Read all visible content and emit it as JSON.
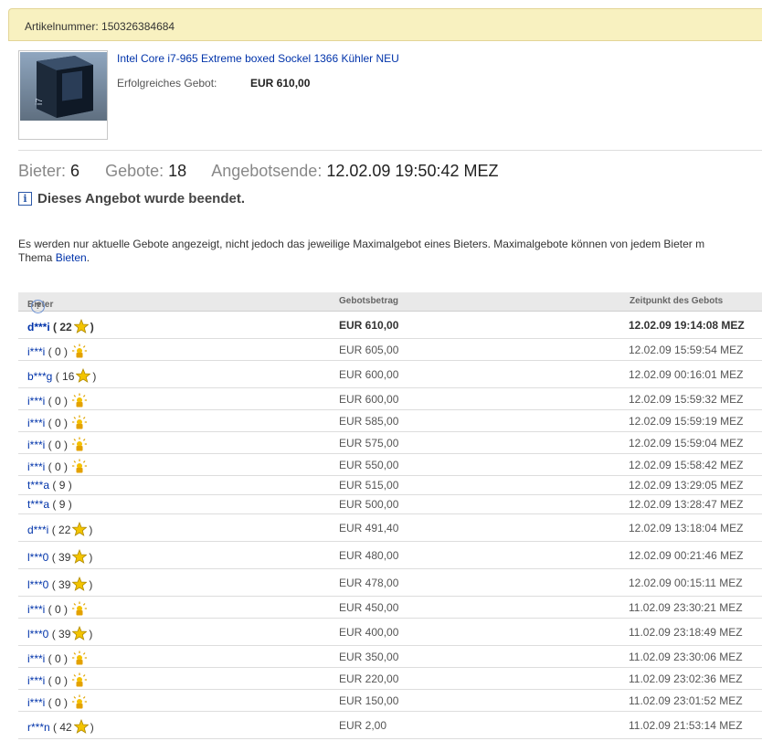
{
  "item": {
    "number_label": "Artikelnummer: 150326384684",
    "title": "Intel Core i7-965 Extreme boxed Sockel 1366 Kühler NEU",
    "winning_label": "Erfolgreiches Gebot:",
    "winning_value": "EUR 610,00"
  },
  "summary": {
    "bidders_label": "Bieter:",
    "bidders_value": "6",
    "bids_label": "Gebote:",
    "bids_value": "18",
    "end_label": "Angebotsende:",
    "end_value": "12.02.09 19:50:42 MEZ"
  },
  "info": {
    "text": "Dieses Angebot wurde beendet."
  },
  "note": {
    "line1": "Es werden nur aktuelle Gebote angezeigt, nicht jedoch das jeweilige Maximalgebot eines Bieters. Maximalgebote können von jedem Bieter m",
    "line2_prefix": "Thema ",
    "link": "Bieten",
    "line2_suffix": "."
  },
  "table": {
    "headers": {
      "bidder": "Bieter",
      "help": "?",
      "amount": "Gebotsbetrag",
      "time": "Zeitpunkt des Gebots"
    },
    "rows": [
      {
        "user": "d***i",
        "score": "( 22",
        "close": ")",
        "icon": "star-icon",
        "amount": "EUR 610,00",
        "time": "12.02.09 19:14:08 MEZ"
      },
      {
        "user": "i***i",
        "score": "( 0 )",
        "close": "",
        "icon": "new-member-icon",
        "amount": "EUR 605,00",
        "time": "12.02.09 15:59:54 MEZ"
      },
      {
        "user": "b***g",
        "score": "( 16",
        "close": ")",
        "icon": "star-icon",
        "amount": "EUR 600,00",
        "time": "12.02.09 00:16:01 MEZ"
      },
      {
        "user": "i***i",
        "score": "( 0 )",
        "close": "",
        "icon": "new-member-icon",
        "amount": "EUR 600,00",
        "time": "12.02.09 15:59:32 MEZ"
      },
      {
        "user": "i***i",
        "score": "( 0 )",
        "close": "",
        "icon": "new-member-icon",
        "amount": "EUR 585,00",
        "time": "12.02.09 15:59:19 MEZ"
      },
      {
        "user": "i***i",
        "score": "( 0 )",
        "close": "",
        "icon": "new-member-icon",
        "amount": "EUR 575,00",
        "time": "12.02.09 15:59:04 MEZ"
      },
      {
        "user": "i***i",
        "score": "( 0 )",
        "close": "",
        "icon": "new-member-icon",
        "amount": "EUR 550,00",
        "time": "12.02.09 15:58:42 MEZ"
      },
      {
        "user": "t***a",
        "score": "( 9 )",
        "close": "",
        "icon": "",
        "amount": "EUR 515,00",
        "time": "12.02.09 13:29:05 MEZ"
      },
      {
        "user": "t***a",
        "score": "( 9 )",
        "close": "",
        "icon": "",
        "amount": "EUR 500,00",
        "time": "12.02.09 13:28:47 MEZ"
      },
      {
        "user": "d***i",
        "score": "( 22",
        "close": ")",
        "icon": "star-icon",
        "amount": "EUR 491,40",
        "time": "12.02.09 13:18:04 MEZ"
      },
      {
        "user": "l***0",
        "score": "( 39",
        "close": ")",
        "icon": "star-icon",
        "amount": "EUR 480,00",
        "time": "12.02.09 00:21:46 MEZ"
      },
      {
        "user": "l***0",
        "score": "( 39",
        "close": ")",
        "icon": "star-icon",
        "amount": "EUR 478,00",
        "time": "12.02.09 00:15:11 MEZ"
      },
      {
        "user": "i***i",
        "score": "( 0 )",
        "close": "",
        "icon": "new-member-icon",
        "amount": "EUR 450,00",
        "time": "11.02.09 23:30:21 MEZ"
      },
      {
        "user": "l***0",
        "score": "( 39",
        "close": ")",
        "icon": "star-icon",
        "amount": "EUR 400,00",
        "time": "11.02.09 23:18:49 MEZ"
      },
      {
        "user": "i***i",
        "score": "( 0 )",
        "close": "",
        "icon": "new-member-icon",
        "amount": "EUR 350,00",
        "time": "11.02.09 23:30:06 MEZ"
      },
      {
        "user": "i***i",
        "score": "( 0 )",
        "close": "",
        "icon": "new-member-icon",
        "amount": "EUR 220,00",
        "time": "11.02.09 23:02:36 MEZ"
      },
      {
        "user": "i***i",
        "score": "( 0 )",
        "close": "",
        "icon": "new-member-icon",
        "amount": "EUR 150,00",
        "time": "11.02.09 23:01:52 MEZ"
      },
      {
        "user": "r***n",
        "score": "( 42",
        "close": ")",
        "icon": "star-icon",
        "amount": "EUR 2,00",
        "time": "11.02.09 21:53:14 MEZ"
      }
    ]
  }
}
